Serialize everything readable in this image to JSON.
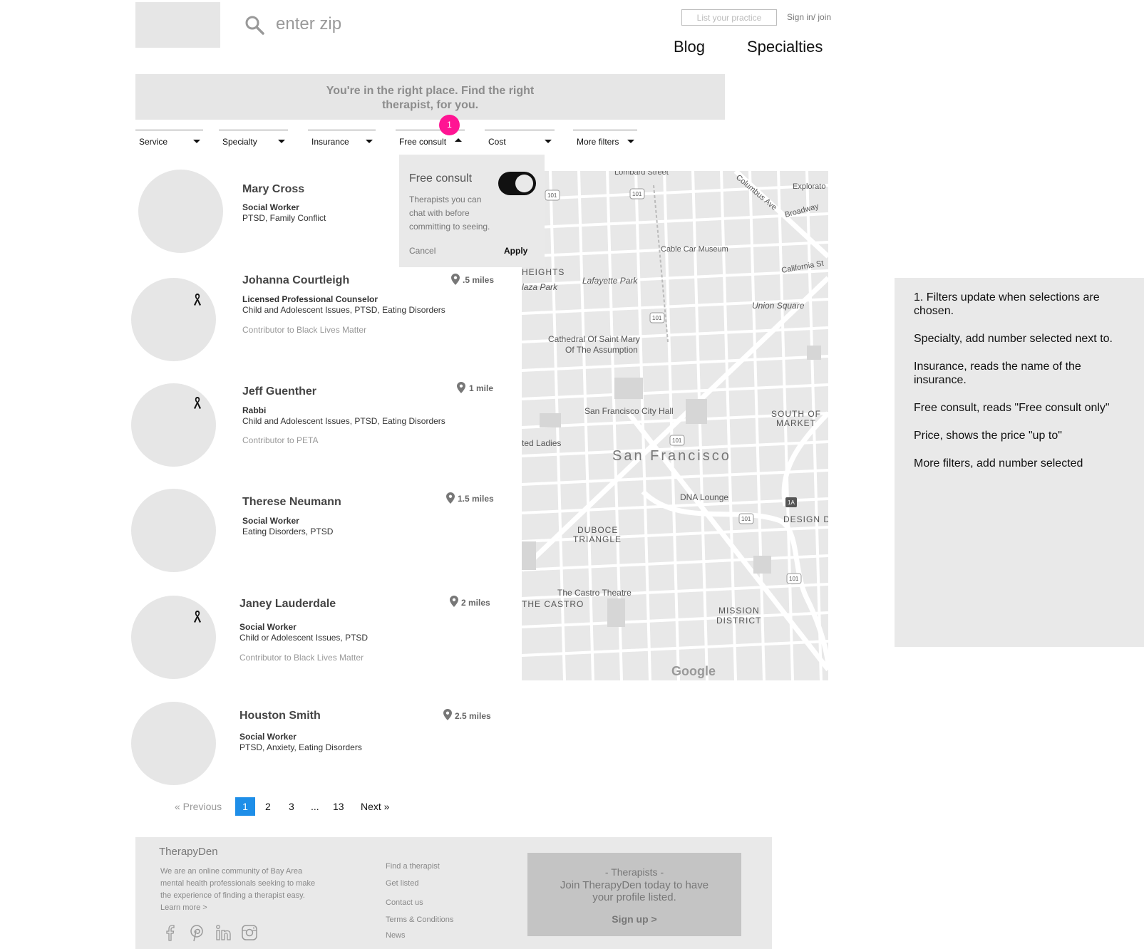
{
  "header": {
    "zip_placeholder": "enter zip",
    "list_practice": "List your practice",
    "sign_in": "Sign in/ join",
    "nav": [
      "Blog",
      "Specialties"
    ]
  },
  "banner": {
    "text": "You're in the right place. Find the right therapist, for you."
  },
  "filters": [
    {
      "label": "Service"
    },
    {
      "label": "Specialty"
    },
    {
      "label": "Insurance"
    },
    {
      "label": "Free consult"
    },
    {
      "label": "Cost"
    },
    {
      "label": "More filters"
    }
  ],
  "badge": "1",
  "popover": {
    "title": "Free consult",
    "description": "Therapists you can chat with before committing to seeing.",
    "cancel": "Cancel",
    "apply": "Apply",
    "toggle_on": true
  },
  "therapists": [
    {
      "name": "Mary Cross",
      "role": "Social Worker",
      "specialties": "PTSD, Family Conflict",
      "contributor": "",
      "distance": ""
    },
    {
      "name": "Johanna Courtleigh",
      "role": "Licensed Professional Counselor",
      "specialties": "Child and Adolescent Issues, PTSD, Eating Disorders",
      "contributor": "Contributor to Black Lives Matter",
      "distance": ".5 miles"
    },
    {
      "name": "Jeff Guenther",
      "role": "Rabbi",
      "specialties": "Child and Adolescent Issues, PTSD, Eating Disorders",
      "contributor": "Contributor to PETA",
      "distance": "1 mile"
    },
    {
      "name": "Therese Neumann",
      "role": "Social Worker",
      "specialties": "Eating Disorders, PTSD",
      "contributor": "",
      "distance": "1.5 miles"
    },
    {
      "name": "Janey Lauderdale",
      "role": "Social Worker",
      "specialties": "Child or Adolescent Issues, PTSD",
      "contributor": "Contributor to Black Lives Matter",
      "distance": "2 miles"
    },
    {
      "name": "Houston Smith",
      "role": "Social Worker",
      "specialties": "PTSD, Anxiety, Eating Disorders",
      "contributor": "",
      "distance": "2.5 miles"
    }
  ],
  "map": {
    "city": "San Francisco",
    "labels": [
      "Lombard Street",
      "Explorato",
      "Columbus Ave",
      "Broadway",
      "Cable Car Museum",
      "Lafayette Park",
      "California St",
      "Union Square",
      "Cathedral Of Saint Mary Of The Assumption",
      "San Francisco City Hall",
      "SOUTH OF MARKET",
      "DNA Lounge",
      "DESIGN D",
      "DUBOCE TRIANGLE",
      "The Castro Theatre",
      "THE CASTRO",
      "MISSION DISTRICT",
      "HEIGHTS",
      "laza Park",
      "ted Ladies",
      "Google"
    ],
    "shields": [
      "101",
      "101",
      "101",
      "101",
      "101",
      "101",
      "101",
      "1A"
    ]
  },
  "notes": [
    "1. Filters update when selections are chosen.",
    "Specialty, add number selected next to.",
    "Insurance, reads the name of the insurance.",
    "Free consult, reads \"Free consult only\"",
    "Price, shows the price \"up to\"",
    "More filters, add number selected"
  ],
  "pagination": {
    "previous": "« Previous",
    "pages": [
      "1",
      "2",
      "3",
      "...",
      "13"
    ],
    "next": "Next »",
    "current": "1"
  },
  "footer": {
    "brand": "TherapyDen",
    "about": "We are an online community of Bay Area mental health professionals seeking to make the experience of finding a therapist easy. Learn more >",
    "links": [
      "Find a therapist",
      "Get listed",
      "Contact us",
      "Terms & Conditions",
      "News"
    ],
    "cta_heading": "- Therapists -",
    "cta_body": "Join TherapyDen today to have your profile listed.",
    "cta_button": "Sign up >",
    "social_icons": [
      "facebook-icon",
      "pinterest-icon",
      "linkedin-icon",
      "instagram-icon"
    ]
  }
}
